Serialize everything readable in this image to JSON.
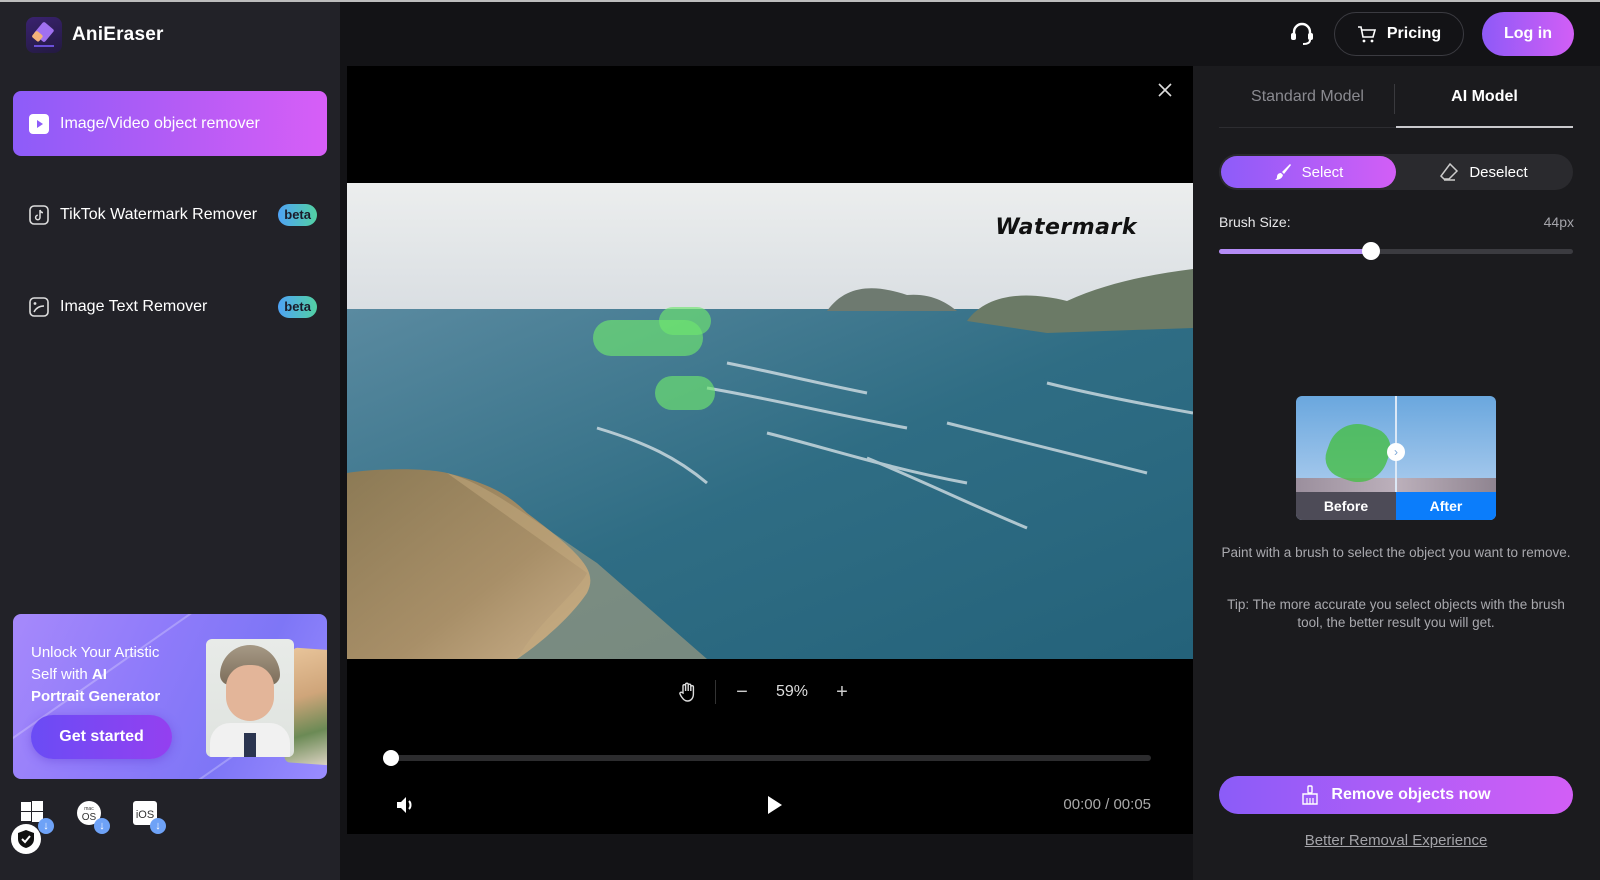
{
  "app": {
    "name": "AniEraser"
  },
  "sidebar": {
    "items": [
      {
        "label": "Image/Video object remover",
        "icon": "play-square-icon",
        "active": true,
        "badge": null
      },
      {
        "label": "TikTok Watermark Remover",
        "icon": "tiktok-icon",
        "active": false,
        "badge": "beta"
      },
      {
        "label": "Image Text Remover",
        "icon": "image-text-icon",
        "active": false,
        "badge": "beta"
      }
    ],
    "promo": {
      "line1": "Unlock Your Artistic",
      "line2": "Self with ",
      "line2_bold": "AI",
      "line3": "Portrait Generator",
      "button": "Get started"
    },
    "downloads": [
      {
        "platform": "Windows",
        "icon": "windows-icon"
      },
      {
        "platform": "macOS",
        "icon": "macos-icon"
      },
      {
        "platform": "iOS",
        "icon": "ios-icon",
        "label": "iOS"
      }
    ]
  },
  "header": {
    "support_icon": "headset-icon",
    "pricing_label": "Pricing",
    "login_label": "Log in"
  },
  "player": {
    "watermark_text": "Watermark",
    "zoom_level": "59%",
    "zoom_out": "−",
    "zoom_in": "+",
    "current_time": "00:00",
    "duration": "00:05",
    "time_display": "00:00 / 00:05",
    "progress": 0
  },
  "panel": {
    "tabs": [
      {
        "label": "Standard Model",
        "active": false
      },
      {
        "label": "AI Model",
        "active": true
      }
    ],
    "modes": [
      {
        "label": "Select",
        "active": true
      },
      {
        "label": "Deselect",
        "active": false
      }
    ],
    "brush": {
      "label": "Brush Size:",
      "value_text": "44px",
      "value_fraction": 0.43
    },
    "demo": {
      "before": "Before",
      "after": "After"
    },
    "hint": "Paint with a brush to select the object you want to remove.",
    "tip": "Tip: The more accurate you select objects with the brush tool, the better result you will get.",
    "remove_button": "Remove objects now",
    "better_link": "Better Removal Experience"
  },
  "colors": {
    "accent_start": "#8d5cf9",
    "accent_end": "#d25ef6",
    "beta_start": "#4fa3f6",
    "beta_end": "#52d1a3",
    "after_blue": "#0b7dfb",
    "mask_green": "#6ee66e"
  }
}
